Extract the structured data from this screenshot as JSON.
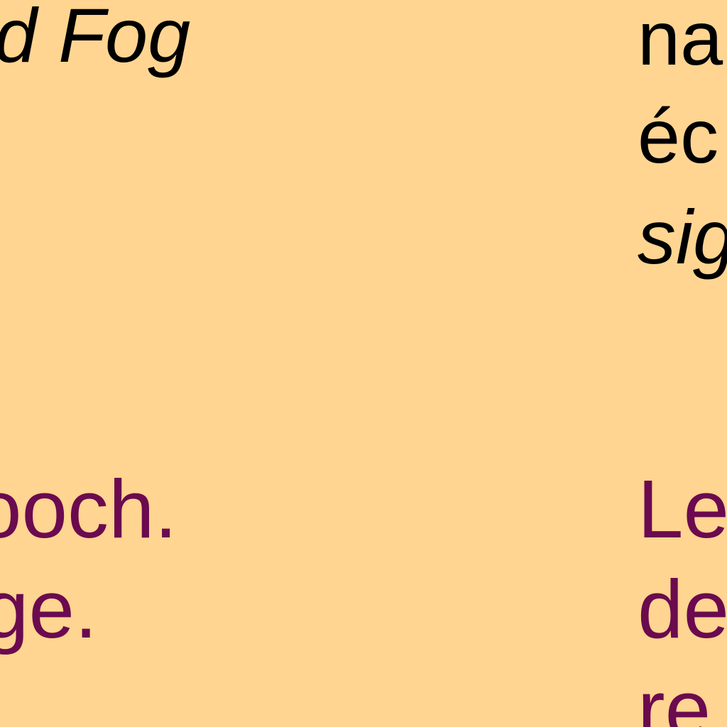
{
  "colors": {
    "background": "#ffd591",
    "body_text": "#000000",
    "accent_text": "#6b0a4f"
  },
  "left_column": {
    "heading_fragment": "d Fog",
    "line_1": "ooch.",
    "line_2": "ge."
  },
  "right_column": {
    "line_1": "na",
    "line_2": "éc",
    "line_3": "sig",
    "line_4": "Le",
    "line_5": "de",
    "line_6": "re"
  }
}
